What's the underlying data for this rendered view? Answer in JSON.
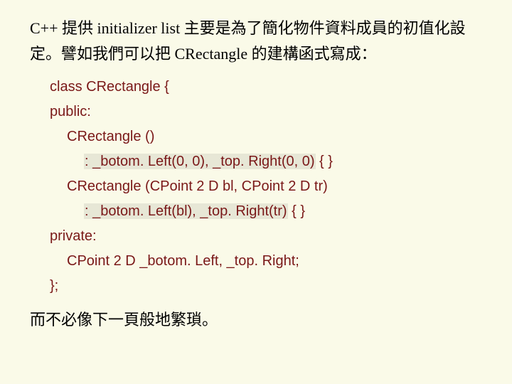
{
  "intro": "C++ 提供 initializer list 主要是為了簡化物件資料成員的初值化設定。譬如我們可以把 CRectangle 的建構函式寫成：",
  "code": {
    "l1": "class CRectangle {",
    "l2": "public:",
    "l3": "CRectangle ()",
    "l4a": ": _botom. Left(0, 0), _top. Right(0, 0)",
    "l4b": " { }",
    "l5": "CRectangle (CPoint 2 D bl, CPoint 2 D tr)",
    "l6a": ": _botom. Left(bl), _top. Right(tr)",
    "l6b": " { }",
    "l7": "private:",
    "l8": "CPoint 2 D _botom. Left, _top. Right;",
    "l9": "};"
  },
  "outro": "而不必像下一頁般地繁瑣。"
}
